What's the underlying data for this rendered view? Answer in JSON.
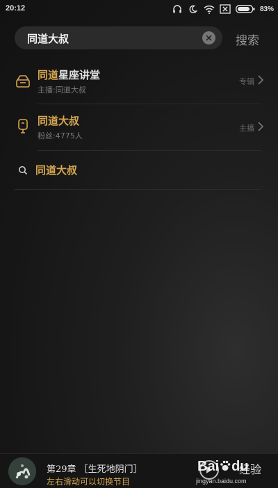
{
  "status_bar": {
    "time": "20:12",
    "battery_percent": "83%",
    "icons": [
      "headphones-icon",
      "moon-icon",
      "wifi-icon",
      "no-sim-icon",
      "battery-icon"
    ]
  },
  "search": {
    "value": "同道大叔",
    "submit_label": "搜索"
  },
  "results": [
    {
      "type_icon": "album-icon",
      "title_highlight": "同道",
      "title_rest": "星座讲堂",
      "subtitle": "主播:同道大叔",
      "tag": "专辑"
    },
    {
      "type_icon": "microphone-icon",
      "title_highlight": "同道大叔",
      "title_rest": "",
      "subtitle": "粉丝:4775人",
      "tag": "主播"
    },
    {
      "type_icon": "search-icon",
      "title_highlight": "同道大叔",
      "title_rest": ""
    }
  ],
  "player": {
    "title": "第29章 ［生死地阴门］",
    "hint": "左右滑动可以切换节目"
  },
  "watermark": {
    "logo": "Bai",
    "logo_suffix": "du",
    "jingyan": "经验",
    "url": "jingyan.baidu.com"
  },
  "colors": {
    "highlight": "#d6a650",
    "background": "#161616"
  }
}
